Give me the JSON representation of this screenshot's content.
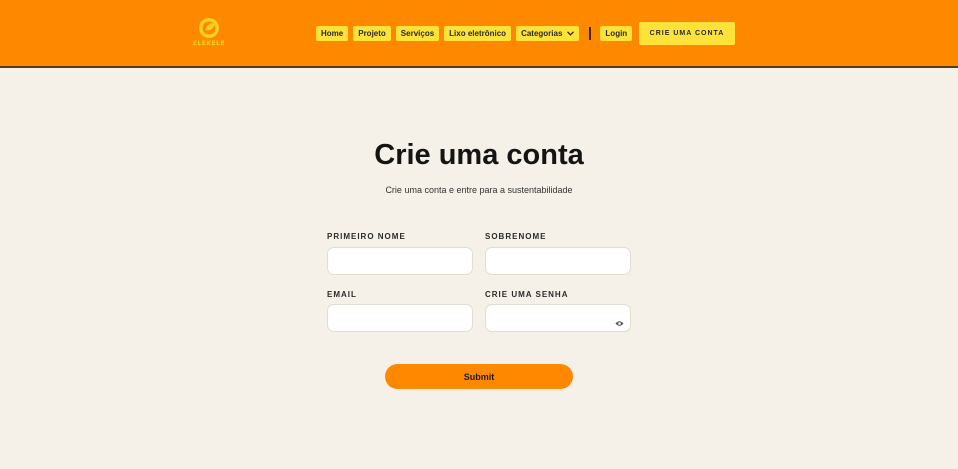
{
  "header": {
    "logo_text": "ELEKELE",
    "nav": [
      {
        "label": "Home"
      },
      {
        "label": "Projeto"
      },
      {
        "label": "Serviços"
      },
      {
        "label": "Lixo eletrônico"
      },
      {
        "label": "Categorias"
      }
    ],
    "login_label": "Login",
    "cta_label": "CRIE UMA CONTA"
  },
  "main": {
    "title": "Crie uma conta",
    "subtitle": "Crie uma conta e entre para a sustentabilidade",
    "form": {
      "first_name_label": "PRIMEIRO NOME",
      "last_name_label": "SOBRENOME",
      "email_label": "EMAIL",
      "password_label": "CRIE UMA SENHA",
      "first_name_value": "",
      "last_name_value": "",
      "email_value": "",
      "password_value": "",
      "submit_label": "Submit"
    }
  },
  "colors": {
    "header_bg": "#fe8800",
    "nav_button_bg": "#fde23a",
    "page_bg": "#f5f1e8",
    "accent": "#fe8800"
  },
  "icons": {
    "logo": "leaf-globe-logo",
    "categorias": "chevron-down-icon",
    "password_toggle": "eye-icon"
  }
}
